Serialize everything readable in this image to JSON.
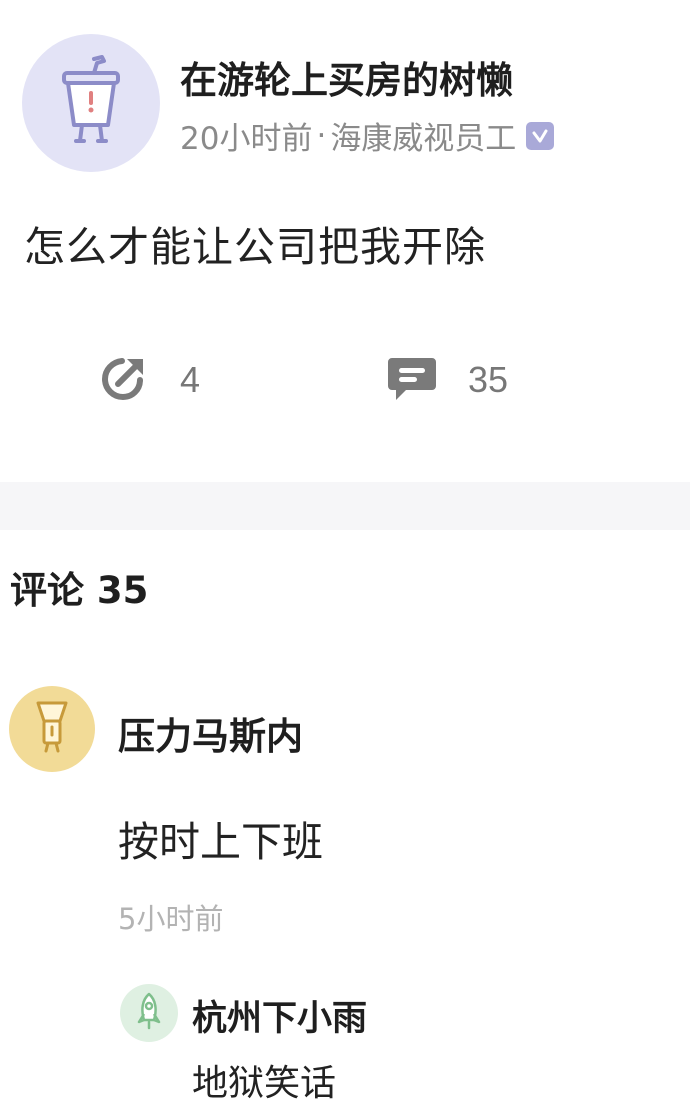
{
  "post": {
    "author": {
      "name": "在游轮上买房的树懒",
      "time": "20小时前",
      "separator": "·",
      "company": "海康威视员工",
      "avatar_icon": "drink-cup-icon",
      "verified_icon": "verified-check-icon"
    },
    "text": "怎么才能让公司把我开除",
    "actions": {
      "share": {
        "icon": "share-icon",
        "count": "4"
      },
      "comment": {
        "icon": "comment-icon",
        "count": "35"
      }
    }
  },
  "comments": {
    "header": "评论 35",
    "items": [
      {
        "name": "压力马斯内",
        "text": "按时上下班",
        "time": "5小时前",
        "avatar_icon": "flashlight-icon",
        "replies": [
          {
            "name": "杭州下小雨",
            "text": "地狱笑话",
            "avatar_icon": "rocket-icon"
          }
        ]
      }
    ]
  },
  "colors": {
    "post_avatar_bg": "#e3e3f6",
    "verified_badge": "#a9a9d8",
    "comment_avatar_bg": "#f2db97",
    "reply_avatar_bg": "#dff0e2",
    "secondary_text": "#8a8a8a"
  }
}
